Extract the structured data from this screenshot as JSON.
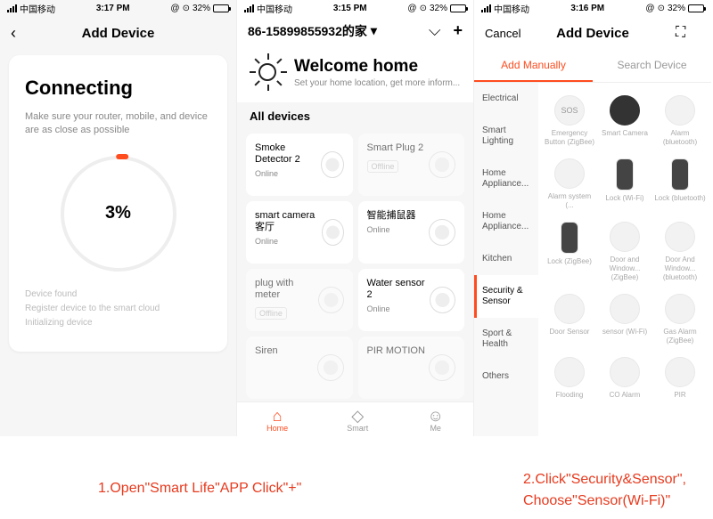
{
  "status": {
    "carrier": "中国移动",
    "alarm_icon": "⏰",
    "loc_icon": "➤",
    "battery_pct": "32%"
  },
  "times": {
    "p1": "3:17 PM",
    "p2": "3:15 PM",
    "p3": "3:16 PM"
  },
  "p1": {
    "title": "Add Device",
    "heading": "Connecting",
    "sub": "Make sure your router, mobile, and device are as close as possible",
    "pct": "3%",
    "steps": [
      "Device found",
      "Register device to the smart cloud",
      "Initializing device"
    ]
  },
  "p2": {
    "title": "86-15899855932的家",
    "welcome_h": "Welcome home",
    "welcome_sub": "Set your home location, get more inform...",
    "section": "All devices",
    "devices": [
      {
        "name": "Smoke Detector 2",
        "status": "Online"
      },
      {
        "name": "Smart Plug 2",
        "status": "Offline"
      },
      {
        "name": "smart camera 客厅",
        "status": "Online"
      },
      {
        "name": "智能捕鼠器",
        "status": "Online"
      },
      {
        "name": "plug with meter",
        "status": "Offline"
      },
      {
        "name": "Water sensor 2",
        "status": "Online"
      },
      {
        "name": "Siren",
        "status": ""
      },
      {
        "name": "PIR MOTION",
        "status": ""
      }
    ],
    "nav": {
      "home": "Home",
      "smart": "Smart",
      "me": "Me"
    }
  },
  "p3": {
    "cancel": "Cancel",
    "title": "Add Device",
    "tab1": "Add Manually",
    "tab2": "Search Device",
    "cats": [
      "Electrical",
      "Smart Lighting",
      "Home Appliance...",
      "Home Appliance...",
      "Kitchen",
      "Security & Sensor",
      "Sport & Health",
      "Others"
    ],
    "products": [
      {
        "label": "Emergency Button (ZigBee)",
        "tag": "SOS"
      },
      {
        "label": "Smart Camera"
      },
      {
        "label": "Alarm (bluetooth)"
      },
      {
        "label": "Alarm system (..."
      },
      {
        "label": "Lock (Wi-Fi)"
      },
      {
        "label": "Lock (bluetooth)"
      },
      {
        "label": "Lock (ZigBee)"
      },
      {
        "label": "Door and Window... (ZigBee)"
      },
      {
        "label": "Door And Window... (bluetooth)"
      },
      {
        "label": "Door Sensor"
      },
      {
        "label": "sensor (Wi-Fi)"
      },
      {
        "label": "Gas Alarm (ZigBee)"
      },
      {
        "label": "Flooding"
      },
      {
        "label": "CO Alarm"
      },
      {
        "label": "PIR"
      }
    ]
  },
  "captions": {
    "c1": "1.Open\"Smart Life\"APP Click\"+\"",
    "c2a": "2.Click\"Security&Sensor\",",
    "c2b": "Choose\"Sensor(Wi-Fi)\""
  }
}
